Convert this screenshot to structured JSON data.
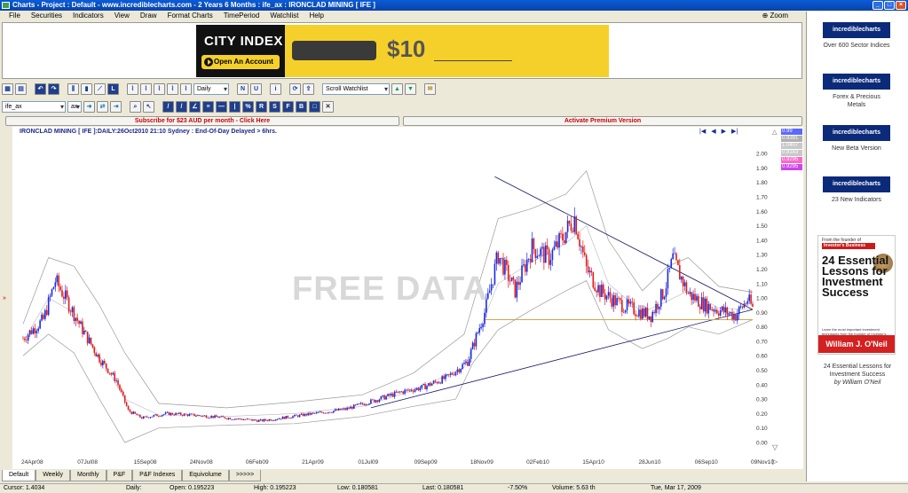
{
  "window": {
    "title": "Charts - Project : Default - www.incrediblecharts.com - 2 Years 6 Months : ife_ax : IRONCLAD MINING  [ IFE ]"
  },
  "menu": [
    {
      "label": "File"
    },
    {
      "label": "Securities"
    },
    {
      "label": "Indicators"
    },
    {
      "label": "View"
    },
    {
      "label": "Draw"
    },
    {
      "label": "Format Charts"
    },
    {
      "label": "TimePeriod"
    },
    {
      "label": "Watchlist"
    },
    {
      "label": "Help"
    }
  ],
  "zoom_label": "Zoom",
  "ad": {
    "logo": "CITY INDEX",
    "cta": "Open An Account",
    "price": "$10"
  },
  "toolbar": {
    "period_select": "Daily",
    "watchlist_select": "Scroll Watchlist",
    "security_input": "ife_ax",
    "exchange_select": "ax"
  },
  "premium": {
    "subscribe": "Subscribe for $23 AUD per month - Click Here",
    "activate": "Activate Premium Version"
  },
  "chart_header": "IRONCLAD MINING [ IFE ]:DAILY:26Oct2010 21:10 Sydney : End-Of-Day Delayed > 6hrs.",
  "watermark": "FREE DATA",
  "price_tags": [
    {
      "value": "0.99",
      "color": "#5a6aff"
    },
    {
      "value": "0.9391",
      "color": "#b0b0b0"
    },
    {
      "value": "1.0407",
      "color": "#c8c8c8"
    },
    {
      "value": "0.8183",
      "color": "#c8c8c8"
    },
    {
      "value": "0.9295",
      "color": "#ff66cc"
    },
    {
      "value": "0.9295",
      "color": "#cc44ee"
    }
  ],
  "tabs": [
    {
      "label": "Default"
    },
    {
      "label": "Weekly"
    },
    {
      "label": "Monthly"
    },
    {
      "label": "P&F"
    },
    {
      "label": "P&F Indexes"
    },
    {
      "label": "Equivolume"
    },
    {
      "label": ">>>>>"
    }
  ],
  "status": {
    "cursor": "Cursor: 1.4034",
    "period": "Daily:",
    "open": "Open: 0.195223",
    "high": "High: 0.195223",
    "low": "Low: 0.180581",
    "last": "Last: 0.180581",
    "change": "-7.50%",
    "volume": "Volume: 5.63 th",
    "date": "Tue, Mar 17, 2009"
  },
  "sidebar": {
    "promos": [
      {
        "badge": "incrediblecharts",
        "text": "Over 600 Sector Indices"
      },
      {
        "badge": "incrediblecharts",
        "text": "Forex & Precious Metals"
      },
      {
        "badge": "incrediblecharts",
        "text": "New Beta Version"
      },
      {
        "badge": "incrediblecharts",
        "text": "23 New Indicators"
      }
    ],
    "book": {
      "tagline": "From the founder of",
      "publisher": "Investor's Business Daily",
      "title": "24 Essential Lessons for Investment Success",
      "subtitle": "Learn the most important investment techniques from the founder of Investor's Business Daily",
      "author": "William J. O'Neil"
    },
    "book_caption": "24 Essential Lessons for Investment Success",
    "book_caption_author": "by William O'Neil"
  },
  "colors": {
    "up_candle": "#1a2ae0",
    "down_candle": "#e01a1a",
    "band": "#9a9a9a",
    "trendline": "#1a1a6a",
    "support": "#d4a64a"
  },
  "chart_data": {
    "type": "candlestick",
    "title": "IRONCLAD MINING [ IFE ]:DAILY:26Oct2010 21:10 Sydney : End-Of-Day Delayed > 6hrs.",
    "x_ticks": [
      "24Apr08",
      "07Jul08",
      "15Sep08",
      "24Nov08",
      "06Feb09",
      "21Apr09",
      "01Jul09",
      "09Sep09",
      "18Nov09",
      "02Feb10",
      "15Apr10",
      "28Jun10",
      "06Sep10",
      "09Nov10"
    ],
    "y_ticks": [
      "0.00",
      "0.10",
      "0.20",
      "0.30",
      "0.40",
      "0.50",
      "0.60",
      "0.70",
      "0.80",
      "0.90",
      "1.00",
      "1.10",
      "1.20",
      "1.30",
      "1.40",
      "1.50",
      "1.60",
      "1.70",
      "1.80",
      "1.90",
      "2.00"
    ],
    "ylim": [
      0,
      2.05
    ],
    "price_path": [
      [
        0,
        0.72
      ],
      [
        12,
        0.85
      ],
      [
        19,
        1.12
      ],
      [
        25,
        1.0
      ],
      [
        35,
        0.78
      ],
      [
        45,
        0.58
      ],
      [
        55,
        0.43
      ],
      [
        62,
        0.22
      ],
      [
        70,
        0.17
      ],
      [
        85,
        0.2
      ],
      [
        100,
        0.19
      ],
      [
        120,
        0.17
      ],
      [
        140,
        0.15
      ],
      [
        165,
        0.19
      ],
      [
        190,
        0.23
      ],
      [
        212,
        0.31
      ],
      [
        223,
        0.35
      ],
      [
        235,
        0.38
      ],
      [
        250,
        0.45
      ],
      [
        262,
        0.56
      ],
      [
        272,
        0.9
      ],
      [
        280,
        1.3
      ],
      [
        290,
        1.05
      ],
      [
        300,
        1.35
      ],
      [
        310,
        1.28
      ],
      [
        318,
        1.42
      ],
      [
        325,
        1.56
      ],
      [
        332,
        1.2
      ],
      [
        340,
        1.05
      ],
      [
        350,
        0.97
      ],
      [
        360,
        0.92
      ],
      [
        370,
        0.88
      ],
      [
        378,
        1.05
      ],
      [
        383,
        1.27
      ],
      [
        392,
        1.03
      ],
      [
        402,
        0.95
      ],
      [
        412,
        0.91
      ],
      [
        420,
        0.88
      ],
      [
        427,
        0.99
      ],
      [
        430,
        0.93
      ]
    ],
    "upper_band_path": [
      [
        0,
        0.82
      ],
      [
        15,
        1.28
      ],
      [
        30,
        1.22
      ],
      [
        45,
        0.95
      ],
      [
        60,
        0.62
      ],
      [
        80,
        0.27
      ],
      [
        120,
        0.24
      ],
      [
        160,
        0.28
      ],
      [
        200,
        0.33
      ],
      [
        230,
        0.48
      ],
      [
        260,
        0.75
      ],
      [
        280,
        1.55
      ],
      [
        300,
        1.62
      ],
      [
        320,
        1.72
      ],
      [
        332,
        1.88
      ],
      [
        345,
        1.4
      ],
      [
        365,
        1.05
      ],
      [
        380,
        1.22
      ],
      [
        392,
        1.28
      ],
      [
        410,
        1.08
      ],
      [
        430,
        1.04
      ]
    ],
    "lower_band_path": [
      [
        0,
        0.6
      ],
      [
        15,
        0.75
      ],
      [
        30,
        0.62
      ],
      [
        45,
        0.3
      ],
      [
        60,
        0.0
      ],
      [
        80,
        0.1
      ],
      [
        120,
        0.12
      ],
      [
        160,
        0.13
      ],
      [
        200,
        0.18
      ],
      [
        230,
        0.25
      ],
      [
        255,
        0.3
      ],
      [
        265,
        0.55
      ],
      [
        280,
        0.78
      ],
      [
        300,
        0.92
      ],
      [
        320,
        1.05
      ],
      [
        332,
        1.12
      ],
      [
        345,
        0.78
      ],
      [
        365,
        0.65
      ],
      [
        380,
        0.72
      ],
      [
        392,
        0.8
      ],
      [
        410,
        0.75
      ],
      [
        430,
        0.85
      ]
    ],
    "mid_band_path": [
      [
        0,
        0.7
      ],
      [
        15,
        1.0
      ],
      [
        30,
        0.9
      ],
      [
        45,
        0.6
      ],
      [
        60,
        0.3
      ],
      [
        80,
        0.19
      ],
      [
        120,
        0.18
      ],
      [
        160,
        0.2
      ],
      [
        200,
        0.25
      ],
      [
        230,
        0.36
      ],
      [
        260,
        0.52
      ],
      [
        280,
        1.1
      ],
      [
        300,
        1.25
      ],
      [
        320,
        1.38
      ],
      [
        332,
        1.5
      ],
      [
        345,
        1.1
      ],
      [
        365,
        0.9
      ],
      [
        380,
        0.98
      ],
      [
        392,
        1.05
      ],
      [
        410,
        0.93
      ],
      [
        430,
        0.92
      ]
    ],
    "x_range": [
      0,
      430
    ],
    "trendlines": [
      {
        "name": "resistance",
        "from": [
          278,
          1.84
        ],
        "to": [
          430,
          0.92
        ]
      },
      {
        "name": "support",
        "from": [
          205,
          0.24
        ],
        "to": [
          430,
          0.92
        ]
      },
      {
        "name": "horizontal",
        "from": [
          272,
          0.85
        ],
        "to": [
          430,
          0.85
        ]
      }
    ],
    "grid": false,
    "legend": "none"
  }
}
